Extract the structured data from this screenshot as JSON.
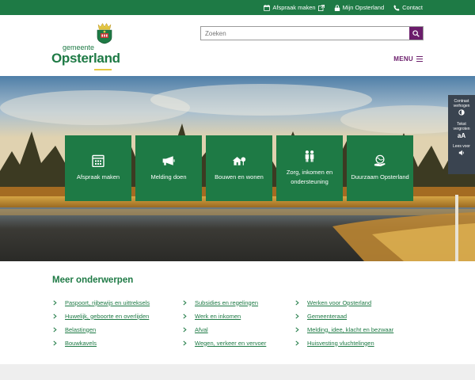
{
  "topbar": {
    "links": [
      {
        "label": "Afspraak maken",
        "icon": "calendar-icon"
      },
      {
        "label": "Mijn Opsterland",
        "icon": "lock-icon"
      },
      {
        "label": "Contact",
        "icon": "phone-icon"
      }
    ]
  },
  "header": {
    "logo_small": "gemeente",
    "logo_big": "Opsterland",
    "search_placeholder": "Zoeken",
    "menu_label": "MENU"
  },
  "hero": {
    "tiles": [
      {
        "label": "Afspraak maken",
        "icon": "calendar-icon"
      },
      {
        "label": "Melding doen",
        "icon": "megaphone-icon"
      },
      {
        "label": "Bouwen en wonen",
        "icon": "house-tree-icon"
      },
      {
        "label": "Zorg, inkomen en ondersteuning",
        "icon": "people-icon"
      },
      {
        "label": "Duurzaam Opsterland",
        "icon": "globe-hand-icon"
      }
    ]
  },
  "a11y": {
    "items": [
      {
        "label": "Contrast verhogen",
        "icon": "contrast-icon"
      },
      {
        "label": "Tekst vergroten",
        "glyph": "aA"
      },
      {
        "label": "Lees voor",
        "icon": "speaker-icon"
      }
    ]
  },
  "topics": {
    "title": "Meer onderwerpen",
    "columns": [
      [
        "Paspoort, rijbewijs en uittreksels",
        "Huwelijk, geboorte en overlijden",
        "Belastingen",
        "Bouwkavels"
      ],
      [
        "Subsidies en regelingen",
        "Werk en inkomen",
        "Afval",
        "Wegen, verkeer en vervoer"
      ],
      [
        "Werken voor Opsterland",
        "Gemeenteraad",
        "Melding, idee, klacht en bezwaar",
        "Huisvesting vluchtelingen"
      ]
    ]
  },
  "colors": {
    "brand_green": "#1e7a45",
    "accent_purple": "#6b1d6b",
    "panel_dark": "#3a4450"
  }
}
